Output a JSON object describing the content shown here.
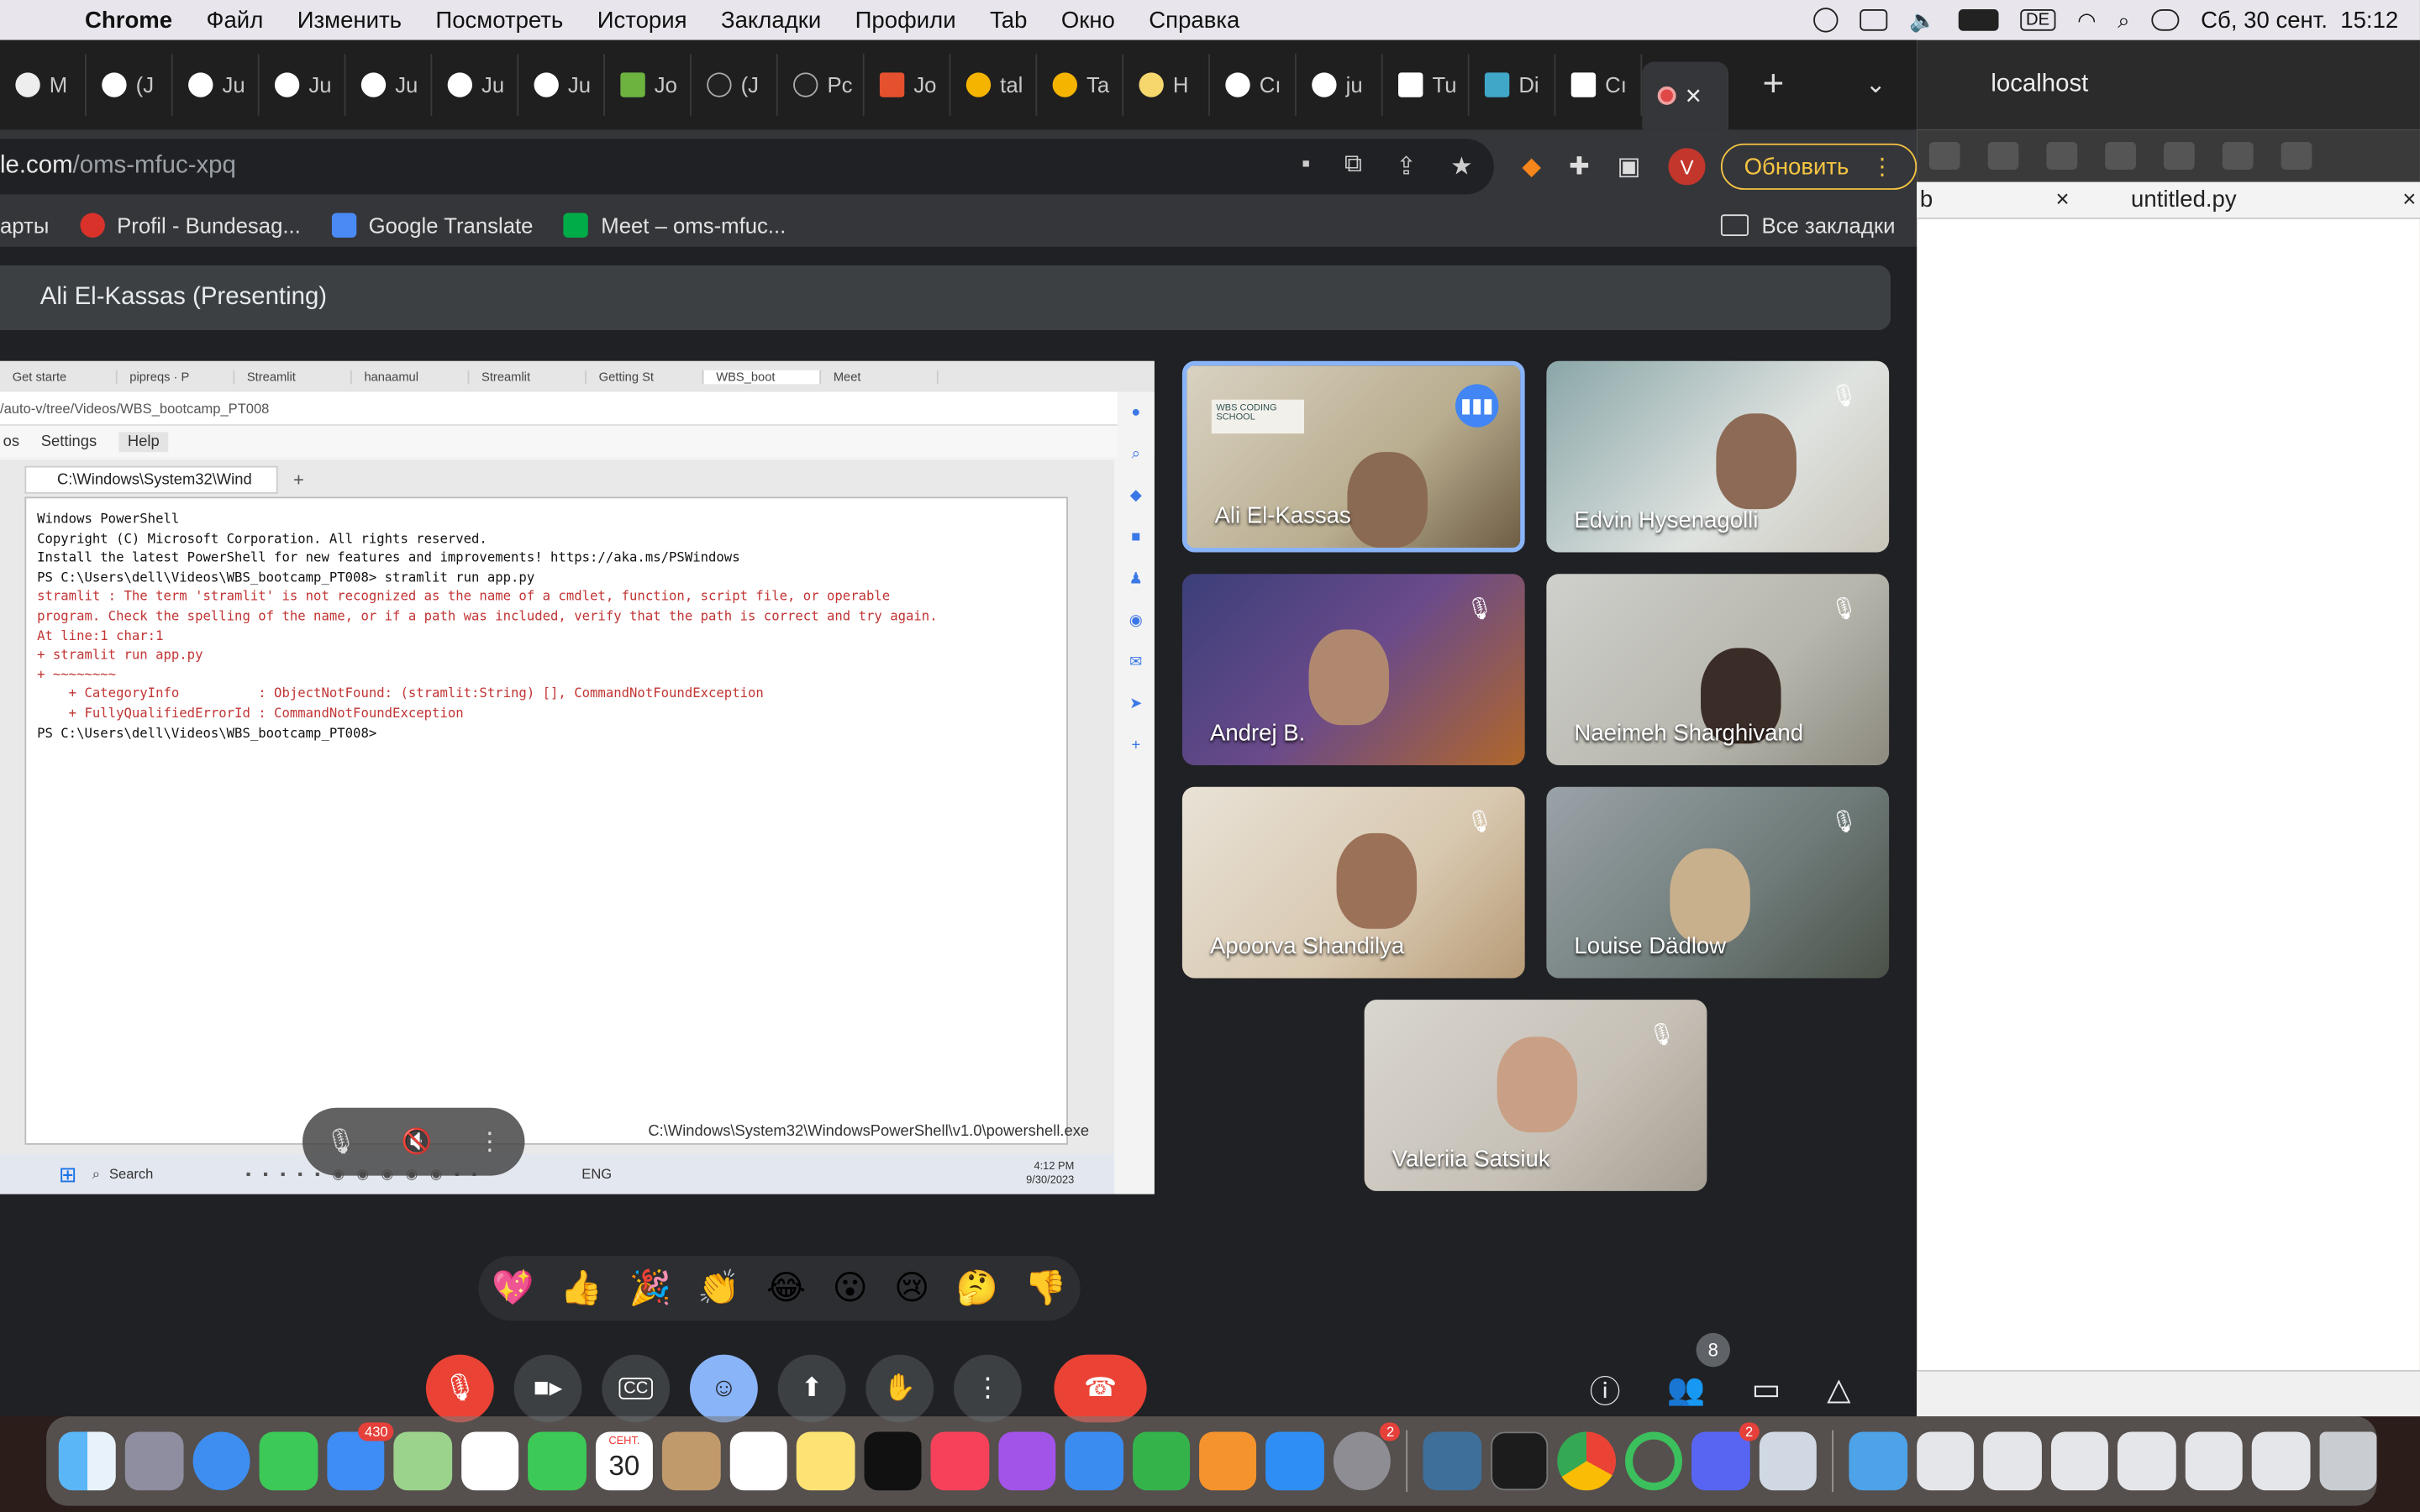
{
  "menubar": {
    "app_name": "Chrome",
    "items": [
      "Файл",
      "Изменить",
      "Посмотреть",
      "История",
      "Закладки",
      "Профили",
      "Tab",
      "Окно",
      "Справка"
    ],
    "keyboard_layout": "DE",
    "datetime": "Сб, 30 сент.  15:12"
  },
  "chrome": {
    "tabs": [
      "M",
      "(J",
      "Ju",
      "Ju",
      "Ju",
      "Ju",
      "Ju",
      "Jo",
      "(J",
      "Pc",
      "Jo",
      "tal",
      "Ta",
      "H",
      "Cı",
      "ju",
      "Tu",
      "Di",
      "Cı"
    ],
    "address_dim": "le.com",
    "address_path": "/oms-mfuc-xpq",
    "profile_initial": "V",
    "update_label": "Обновить",
    "bookmarks": [
      {
        "label": "арты"
      },
      {
        "label": "Profil - Bundesag..."
      },
      {
        "label": "Google Translate"
      },
      {
        "label": "Meet – oms-mfuc..."
      }
    ],
    "all_bookmarks": "Все закладки"
  },
  "meet": {
    "presenting_label": "Ali El-Kassas (Presenting)",
    "participants": [
      {
        "name": "Ali El-Kassas",
        "speaking": true,
        "logo_text": "WBS CODING SCHOOL"
      },
      {
        "name": "Edvin Hysenagolli",
        "muted": true
      },
      {
        "name": "Andrej B.",
        "muted": true
      },
      {
        "name": "Naeimeh Sharghivand",
        "muted": true
      },
      {
        "name": "Apoorva Shandilya",
        "muted": true
      },
      {
        "name": "Louise Dädlow",
        "muted": true
      },
      {
        "name": "Valeriia Satsiuk",
        "muted": true
      }
    ],
    "participant_count": "8",
    "reactions": [
      "💖",
      "👍",
      "🎉",
      "👏",
      "😂",
      "😮",
      "😢",
      "🤔",
      "👎"
    ]
  },
  "shared_screen": {
    "browser_tabs": [
      "Get starte",
      "pipreqs · P",
      "Streamlit",
      "hanaamul",
      "Streamlit",
      "Getting St",
      "WBS_boot",
      "Meet"
    ],
    "address": "/auto-v/tree/Videos/WBS_bootcamp_PT008",
    "jupyter_menus": [
      "os",
      "Settings",
      "Help"
    ],
    "terminal_tab": "C:\\Windows\\System32\\Wind",
    "terminal_lines": [
      {
        "text": "Windows PowerShell",
        "error": false
      },
      {
        "text": "Copyright (C) Microsoft Corporation. All rights reserved.",
        "error": false
      },
      {
        "text": "",
        "error": false
      },
      {
        "text": "Install the latest PowerShell for new features and improvements! https://aka.ms/PSWindows",
        "error": false
      },
      {
        "text": "",
        "error": false
      },
      {
        "text": "PS C:\\Users\\dell\\Videos\\WBS_bootcamp_PT008> stramlit run app.py",
        "error": false
      },
      {
        "text": "stramlit : The term 'stramlit' is not recognized as the name of a cmdlet, function, script file, or operable",
        "error": true
      },
      {
        "text": "program. Check the spelling of the name, or if a path was included, verify that the path is correct and try again.",
        "error": true
      },
      {
        "text": "At line:1 char:1",
        "error": true
      },
      {
        "text": "+ stramlit run app.py",
        "error": true
      },
      {
        "text": "+ ~~~~~~~~",
        "error": true
      },
      {
        "text": "    + CategoryInfo          : ObjectNotFound: (stramlit:String) [], CommandNotFoundException",
        "error": true
      },
      {
        "text": "    + FullyQualifiedErrorId : CommandNotFoundException",
        "error": true
      },
      {
        "text": "",
        "error": false
      },
      {
        "text": "PS C:\\Users\\dell\\Videos\\WBS_bootcamp_PT008> ",
        "error": false
      }
    ],
    "status_path": "C:\\Windows\\System32\\WindowsPowerShell\\v1.0\\powershell.exe",
    "taskbar_search": "Search",
    "taskbar_lang": "ENG",
    "taskbar_time": "4:12 PM",
    "taskbar_date": "9/30/2023"
  },
  "side_window": {
    "tab_title": "localhost",
    "file_tab_partial": "b",
    "file_tab": "untitled.py"
  },
  "dock": {
    "mail_badge": "430",
    "calendar_month": "СЕНТ.",
    "calendar_day": "30",
    "settings_badge": "2",
    "discord_badge": "2"
  },
  "colors": {
    "meet_bg": "#202124",
    "danger": "#ea4335",
    "accent_blue": "#8ab4f8",
    "update_yellow": "#f5c542"
  }
}
